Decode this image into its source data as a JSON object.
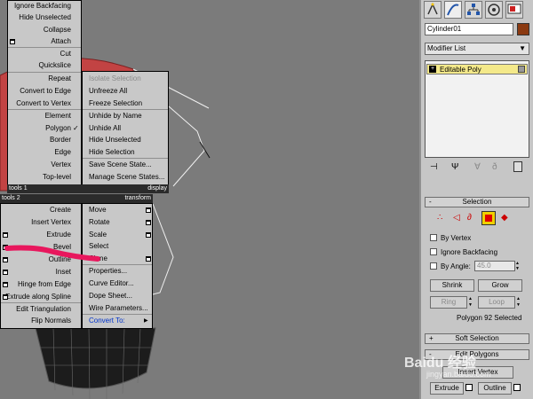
{
  "quad_menu": {
    "tools1": {
      "title": "tools 1",
      "display_title": "display",
      "items": [
        "Ignore Backfacing",
        "Hide Unselected",
        "Collapse",
        "Attach",
        "Cut",
        "Quickslice",
        "Repeat",
        "Convert to Edge",
        "Convert to Vertex",
        "Element",
        "Polygon",
        "Border",
        "Edge",
        "Vertex",
        "Top-level"
      ],
      "checkmark": "✓"
    },
    "display": {
      "items": [
        "Isolate Selection",
        "Unfreeze All",
        "Freeze Selection",
        "Unhide by Name",
        "Unhide All",
        "Hide Unselected",
        "Hide Selection",
        "Save Scene State...",
        "Manage Scene States..."
      ]
    },
    "tools2": {
      "title": "tools 2",
      "transform_title": "transform",
      "items": [
        "Create",
        "Insert Vertex",
        "Extrude",
        "Bevel",
        "Outline",
        "Inset",
        "Hinge from Edge",
        "Extrude along Spline",
        "Edit Triangulation",
        "Flip Normals"
      ]
    },
    "transform": {
      "items": [
        "Move",
        "Rotate",
        "Scale",
        "Select",
        "Clone",
        "Properties...",
        "Curve Editor...",
        "Dope Sheet...",
        "Wire Parameters...",
        "Convert To:"
      ],
      "submenu_arrow": "▶"
    }
  },
  "command_panel": {
    "object_name": "Cylinder01",
    "object_color": "#8b3a12",
    "modifier_list_label": "Modifier List",
    "stack_item": "Editable Poly",
    "selection": {
      "header": "Selection",
      "header_sign": "-",
      "by_vertex": "By Vertex",
      "ignore_backfacing": "Ignore Backfacing",
      "by_angle": "By Angle:",
      "angle_value": "45.0",
      "shrink": "Shrink",
      "grow": "Grow",
      "ring": "Ring",
      "loop": "Loop",
      "status": "Polygon 92 Selected"
    },
    "soft_selection": {
      "header": "Soft Selection",
      "header_sign": "+"
    },
    "edit_polygons": {
      "header": "Edit Polygons",
      "header_sign": "-",
      "insert_vertex": "Insert Vertex",
      "extrude": "Extrude",
      "outline": "Outline"
    }
  },
  "watermark": {
    "main": "Baidu 经验",
    "sub": "jingyan.baidu.com"
  },
  "colors": {
    "viewport": "#7b7b7b",
    "menu_bg": "#c8c8c8",
    "selected_face": "#c24343",
    "highlight_stroke": "#e8175d",
    "stack_highlight": "#f4e98a",
    "active_subobject": "#e00000"
  }
}
